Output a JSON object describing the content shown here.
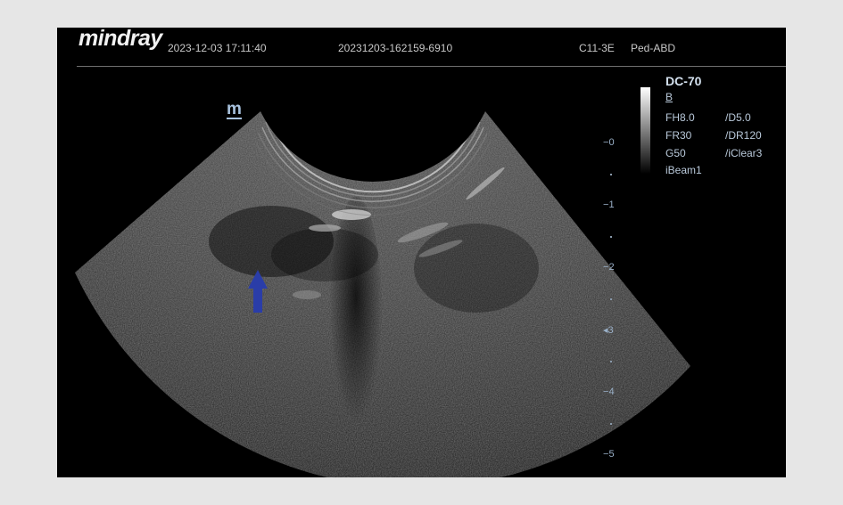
{
  "header": {
    "logo": "mindray",
    "datetime": "2023-12-03 17:11:40",
    "exam_id": "20231203-162159-6910",
    "probe": "C11-3E",
    "preset": "Ped-ABD"
  },
  "image": {
    "probe_marker": "m",
    "arrow_color": "#2a3da8",
    "depth_scale": [
      "0",
      "1",
      "2",
      "3",
      "4",
      "5"
    ],
    "focus_marker": "3"
  },
  "params": {
    "model": "DC-70",
    "mode": "B",
    "rows": [
      [
        "FH8.0",
        "/D5.0"
      ],
      [
        "FR30",
        "/DR120"
      ],
      [
        "G50",
        "/iClear3"
      ],
      [
        "iBeam1",
        ""
      ]
    ]
  }
}
